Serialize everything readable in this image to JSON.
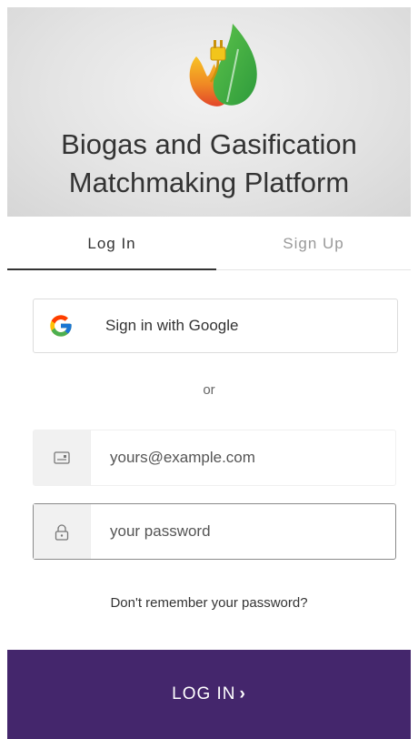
{
  "header": {
    "title": "Biogas and Gasification\nMatchmaking Platform",
    "logo_icon": "leaf-flame-plug-icon"
  },
  "tabs": [
    {
      "label": "Log In",
      "active": true
    },
    {
      "label": "Sign Up",
      "active": false
    }
  ],
  "google": {
    "label": "Sign in with Google",
    "icon": "google-icon"
  },
  "divider_text": "or",
  "email": {
    "placeholder": "yours@example.com",
    "value": "",
    "icon": "email-card-icon"
  },
  "password": {
    "placeholder": "your password",
    "value": "",
    "icon": "lock-icon"
  },
  "forgot_link": "Don't remember your password?",
  "submit": {
    "label": "LOG IN",
    "icon": "chevron-right-icon",
    "color": "#44266c"
  }
}
